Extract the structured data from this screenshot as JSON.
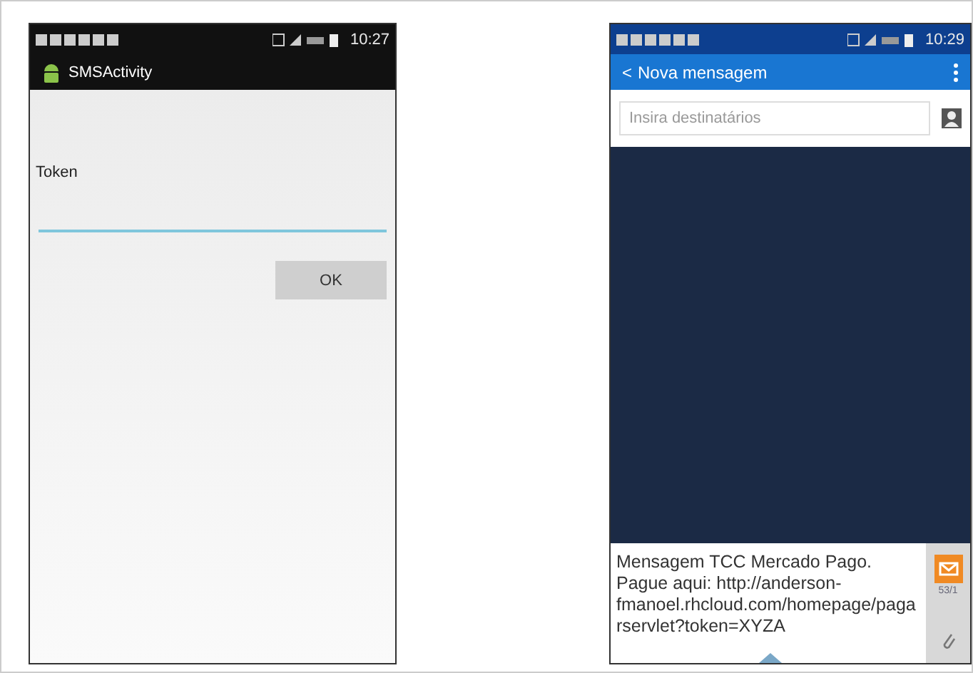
{
  "left_screen": {
    "status_bar": {
      "time": "10:27"
    },
    "action_bar": {
      "title": "SMSActivity"
    },
    "form": {
      "label": "Token",
      "button": "OK"
    }
  },
  "right_screen": {
    "status_bar": {
      "time": "10:29"
    },
    "action_bar": {
      "back": "<",
      "title": "Nova mensagem"
    },
    "recipients": {
      "placeholder": "Insira destinatários"
    },
    "compose": {
      "message": "Mensagem TCC Mercado Pago. Pague aqui: http://anderson-fmanoel.rhcloud.com/homepage/pagarservlet?token=XYZA",
      "counter": "53/1"
    }
  }
}
